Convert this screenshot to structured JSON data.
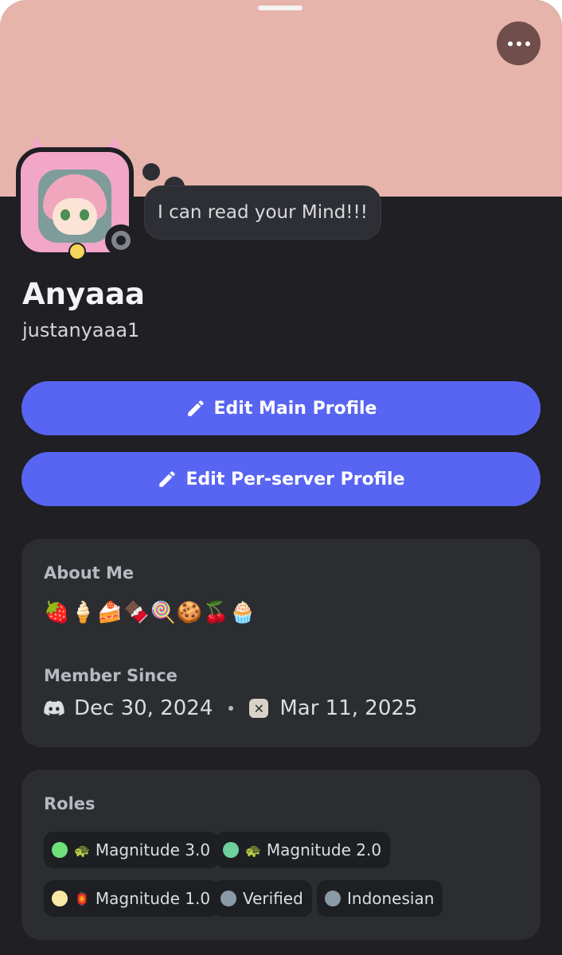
{
  "profile": {
    "status_bubble": "I can read your Mind!!!",
    "display_name": "Anyaaa",
    "username": "justanyaaa1",
    "banner_color": "#e6b4aa"
  },
  "actions": {
    "edit_main": "Edit Main Profile",
    "edit_per_server": "Edit Per-server Profile",
    "button_color": "#5865f2"
  },
  "about": {
    "title": "About Me",
    "emojis": "🍓🍦🍰🍫🍭🍪🍒🧁"
  },
  "member_since": {
    "title": "Member Since",
    "discord_date": "Dec 30, 2024",
    "server_date": "Mar 11, 2025"
  },
  "roles": {
    "title": "Roles",
    "items": [
      {
        "label": "Magnitude 3.0",
        "color": "#6ee07a",
        "icon": "🐢"
      },
      {
        "label": "Magnitude 2.0",
        "color": "#6fcf9e",
        "icon": "🐢"
      },
      {
        "label": "Magnitude 1.0",
        "color": "#f7e8a4",
        "icon": "🏮"
      },
      {
        "label": "Verified",
        "color": "#8a9aa6",
        "icon": ""
      },
      {
        "label": "Indonesian",
        "color": "#8a9aa6",
        "icon": ""
      }
    ]
  },
  "icons": {
    "more": "more-options-icon",
    "edit": "pencil-icon",
    "discord": "discord-logo-icon",
    "server": "server-icon",
    "status": "idle-status-icon"
  }
}
